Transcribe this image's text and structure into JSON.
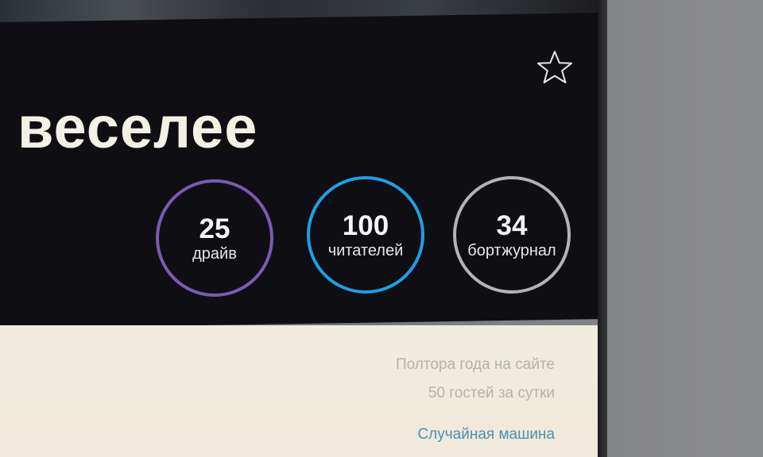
{
  "profile": {
    "title": "веселее"
  },
  "stats": [
    {
      "value": "25",
      "label": "драйв",
      "accent": "#7c5ab0"
    },
    {
      "value": "100",
      "label": "читателей",
      "accent": "#1e9fe6"
    },
    {
      "value": "34",
      "label": "бортжурнал",
      "accent": "#b4b4b4"
    }
  ],
  "meta": {
    "site_time": "Полтора года на сайте",
    "guests": "50 гостей за сутки",
    "random_link": "Случайная машина"
  },
  "icons": {
    "favorite": "star-outline-icon"
  }
}
